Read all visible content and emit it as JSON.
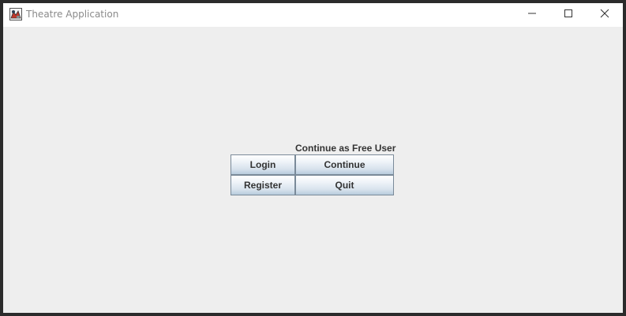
{
  "window": {
    "title": "Theatre Application",
    "icon": "theatre-app-icon",
    "controls": {
      "minimize_icon": "minimize-icon",
      "maximize_icon": "maximize-icon",
      "close_icon": "close-icon"
    }
  },
  "main": {
    "free_user_label": "Continue as Free User",
    "buttons": {
      "login": "Login",
      "continue": "Continue",
      "register": "Register",
      "quit": "Quit"
    }
  },
  "colors": {
    "background": "#eeeeee",
    "titlebar": "#ffffff",
    "button_border": "#7a8a99",
    "text": "#333333"
  }
}
